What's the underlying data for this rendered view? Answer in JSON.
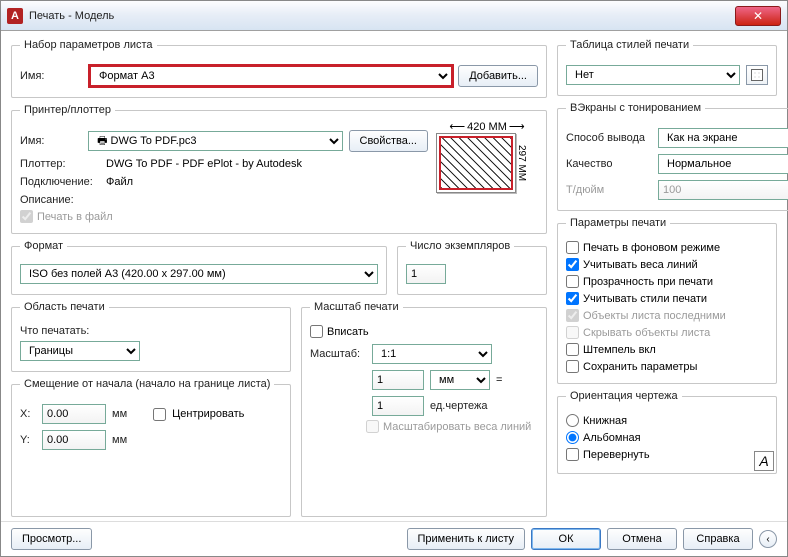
{
  "window": {
    "title": "Печать - Модель",
    "close_symbol": "✕"
  },
  "sheet": {
    "legend": "Набор параметров листа",
    "name_label": "Имя:",
    "name_value": "Формат А3",
    "add_btn": "Добавить..."
  },
  "printer": {
    "legend": "Принтер/плоттер",
    "name_label": "Имя:",
    "name_value": "🖶 DWG To PDF.pc3",
    "props_btn": "Свойства...",
    "plotter_label": "Плоттер:",
    "plotter_value": "DWG To PDF - PDF ePlot - by Autodesk",
    "conn_label": "Подключение:",
    "conn_value": "Файл",
    "desc_label": "Описание:",
    "to_file": "Печать в файл",
    "preview_w": "420 MM",
    "preview_h": "297 MM"
  },
  "format": {
    "legend": "Формат",
    "size": "ISO без полей A3 (420.00 x 297.00 мм)"
  },
  "copies": {
    "legend": "Число экземпляров",
    "value": "1"
  },
  "area": {
    "legend": "Область печати",
    "what_label": "Что печатать:",
    "what_value": "Границы"
  },
  "scale": {
    "legend": "Масштаб печати",
    "fit": "Вписать",
    "label": "Масштаб:",
    "ratio": "1:1",
    "mm_val": "1",
    "mm_unit": "мм",
    "du_val": "1",
    "du_unit": "ед.чертежа",
    "eq": "=",
    "scale_lw": "Масштабировать веса линий"
  },
  "offset": {
    "legend": "Смещение от начала (начало на границе листа)",
    "x_label": "X:",
    "x_val": "0.00",
    "y_label": "Y:",
    "y_val": "0.00",
    "unit": "мм",
    "center": "Центрировать"
  },
  "plotstyle": {
    "legend": "Таблица стилей печати",
    "value": "Нет"
  },
  "viewport": {
    "legend": "ВЭкраны с тонированием",
    "mode_label": "Способ вывода",
    "mode_value": "Как на экране",
    "quality_label": "Качество",
    "quality_value": "Нормальное",
    "dpi_label": "Т/дюйм",
    "dpi_value": "100"
  },
  "options": {
    "legend": "Параметры печати",
    "bg": "Печать в фоновом режиме",
    "lw": "Учитывать веса линий",
    "transp": "Прозрачность при печати",
    "styles": "Учитывать стили печати",
    "last": "Объекты листа последними",
    "hide": "Скрывать объекты листа",
    "stamp": "Штемпель вкл",
    "save": "Сохранить параметры"
  },
  "orient": {
    "legend": "Ориентация чертежа",
    "portrait": "Книжная",
    "landscape": "Альбомная",
    "upside": "Перевернуть",
    "a": "A"
  },
  "footer": {
    "preview": "Просмотр...",
    "apply": "Применить к листу",
    "ok": "ОК",
    "cancel": "Отмена",
    "help": "Справка",
    "collapse": "‹"
  }
}
